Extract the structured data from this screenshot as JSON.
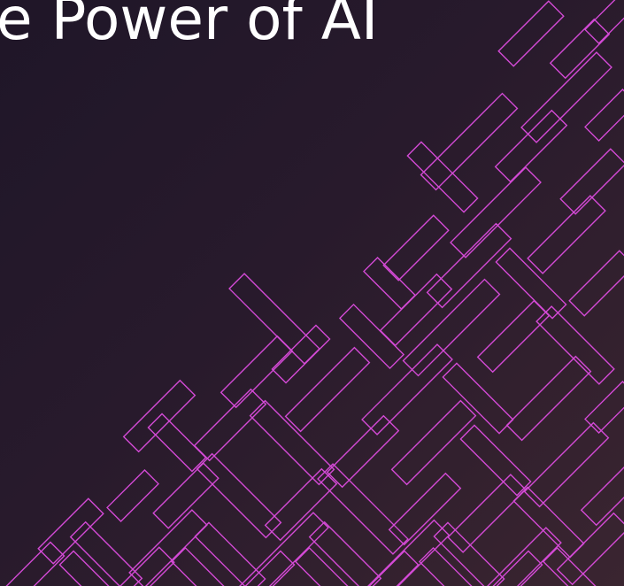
{
  "slide": {
    "headline": "e Power of AI"
  },
  "decoration": {
    "pattern_icon": "diagonal-maze-line-pattern",
    "line_color": "#d44ad6",
    "background_colors": [
      "#1f1628",
      "#3a2530"
    ]
  }
}
